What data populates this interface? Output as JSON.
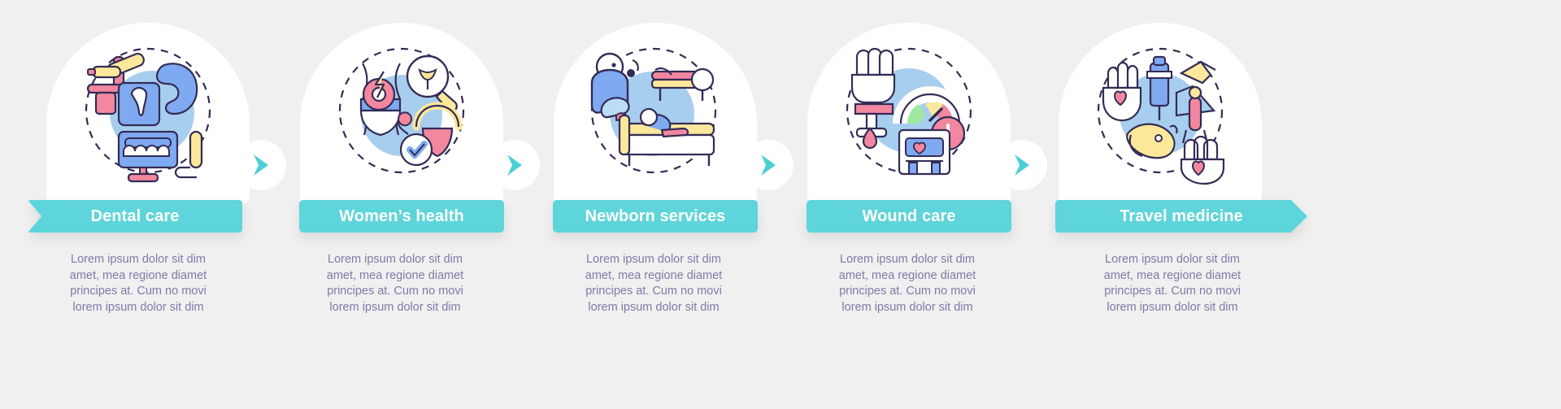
{
  "background_color": "#f0f0f0",
  "accent_color": "#5ed5da",
  "text_color": "#7f7aa8",
  "banner_text_color": "#ffffff",
  "chevron_color": "#4ecfd6",
  "steps": [
    {
      "label": "Dental care",
      "icon": "dental-chair-teeth-icon",
      "banner_shape": "notched-left",
      "description": "Lorem ipsum dolor sit dim amet, mea regione diamet principes at. Cum no movi lorem ipsum dolor sit dim"
    },
    {
      "label": "Women’s health",
      "icon": "womens-health-uterus-icon",
      "banner_shape": "rounded-rect",
      "description": "Lorem ipsum dolor sit dim amet, mea regione diamet principes at. Cum no movi lorem ipsum dolor sit dim"
    },
    {
      "label": "Newborn services",
      "icon": "newborn-baby-crib-icon",
      "banner_shape": "rounded-rect",
      "description": "Lorem ipsum dolor sit dim amet, mea regione diamet principes at. Cum no movi lorem ipsum dolor sit dim"
    },
    {
      "label": "Wound care",
      "icon": "wound-bandage-hospital-icon",
      "banner_shape": "rounded-rect",
      "description": "Lorem ipsum dolor sit dim amet, mea regione diamet principes at. Cum no movi lorem ipsum dolor sit dim"
    },
    {
      "label": "Travel medicine",
      "icon": "travel-vaccine-syringe-icon",
      "banner_shape": "arrow-right",
      "description": "Lorem ipsum dolor sit dim amet, mea regione diamet principes at. Cum no movi lorem ipsum dolor sit dim"
    }
  ],
  "connectors": [
    {
      "icon": "chevron-right-icon"
    },
    {
      "icon": "chevron-right-icon"
    },
    {
      "icon": "chevron-right-icon"
    },
    {
      "icon": "chevron-right-icon"
    }
  ]
}
